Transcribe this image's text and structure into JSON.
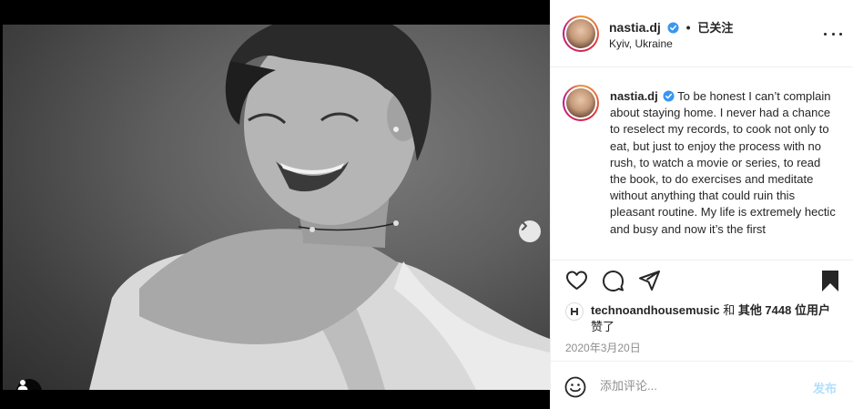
{
  "post": {
    "username": "nastia.dj",
    "separator": "•",
    "follow_status": "已关注",
    "location": "Kyiv, Ukraine",
    "caption": "To be honest I can’t complain about staying home. I never had a chance to reselect my records, to cook not only to eat, but just to enjoy the process with no rush, to watch a movie or series, to read the book, to do exercises and meditate without anything that could ruin this pleasant routine. My life is extremely hectic and busy and now it’s the first",
    "likes": {
      "first_user": "technoandhousemusic",
      "connector": " 和 ",
      "others": "其他 7448 位用户",
      "suffix": "赞了"
    },
    "date": "2020年3月20日",
    "carousel": {
      "current": 1,
      "total": 2
    }
  },
  "comment": {
    "placeholder": "添加评论...",
    "post_label": "发布"
  },
  "icons": {
    "verified": "verified-badge-icon",
    "more": "more-options-icon",
    "like": "heart-icon",
    "comment": "comment-icon",
    "share": "send-icon",
    "save": "bookmark-icon",
    "emoji": "emoji-icon",
    "next": "chevron-right-icon",
    "tags": "user-tag-icon"
  },
  "colors": {
    "verified": "#3897f0",
    "post_button_disabled": "#b2dffc",
    "muted_text": "#8e8e8e"
  }
}
